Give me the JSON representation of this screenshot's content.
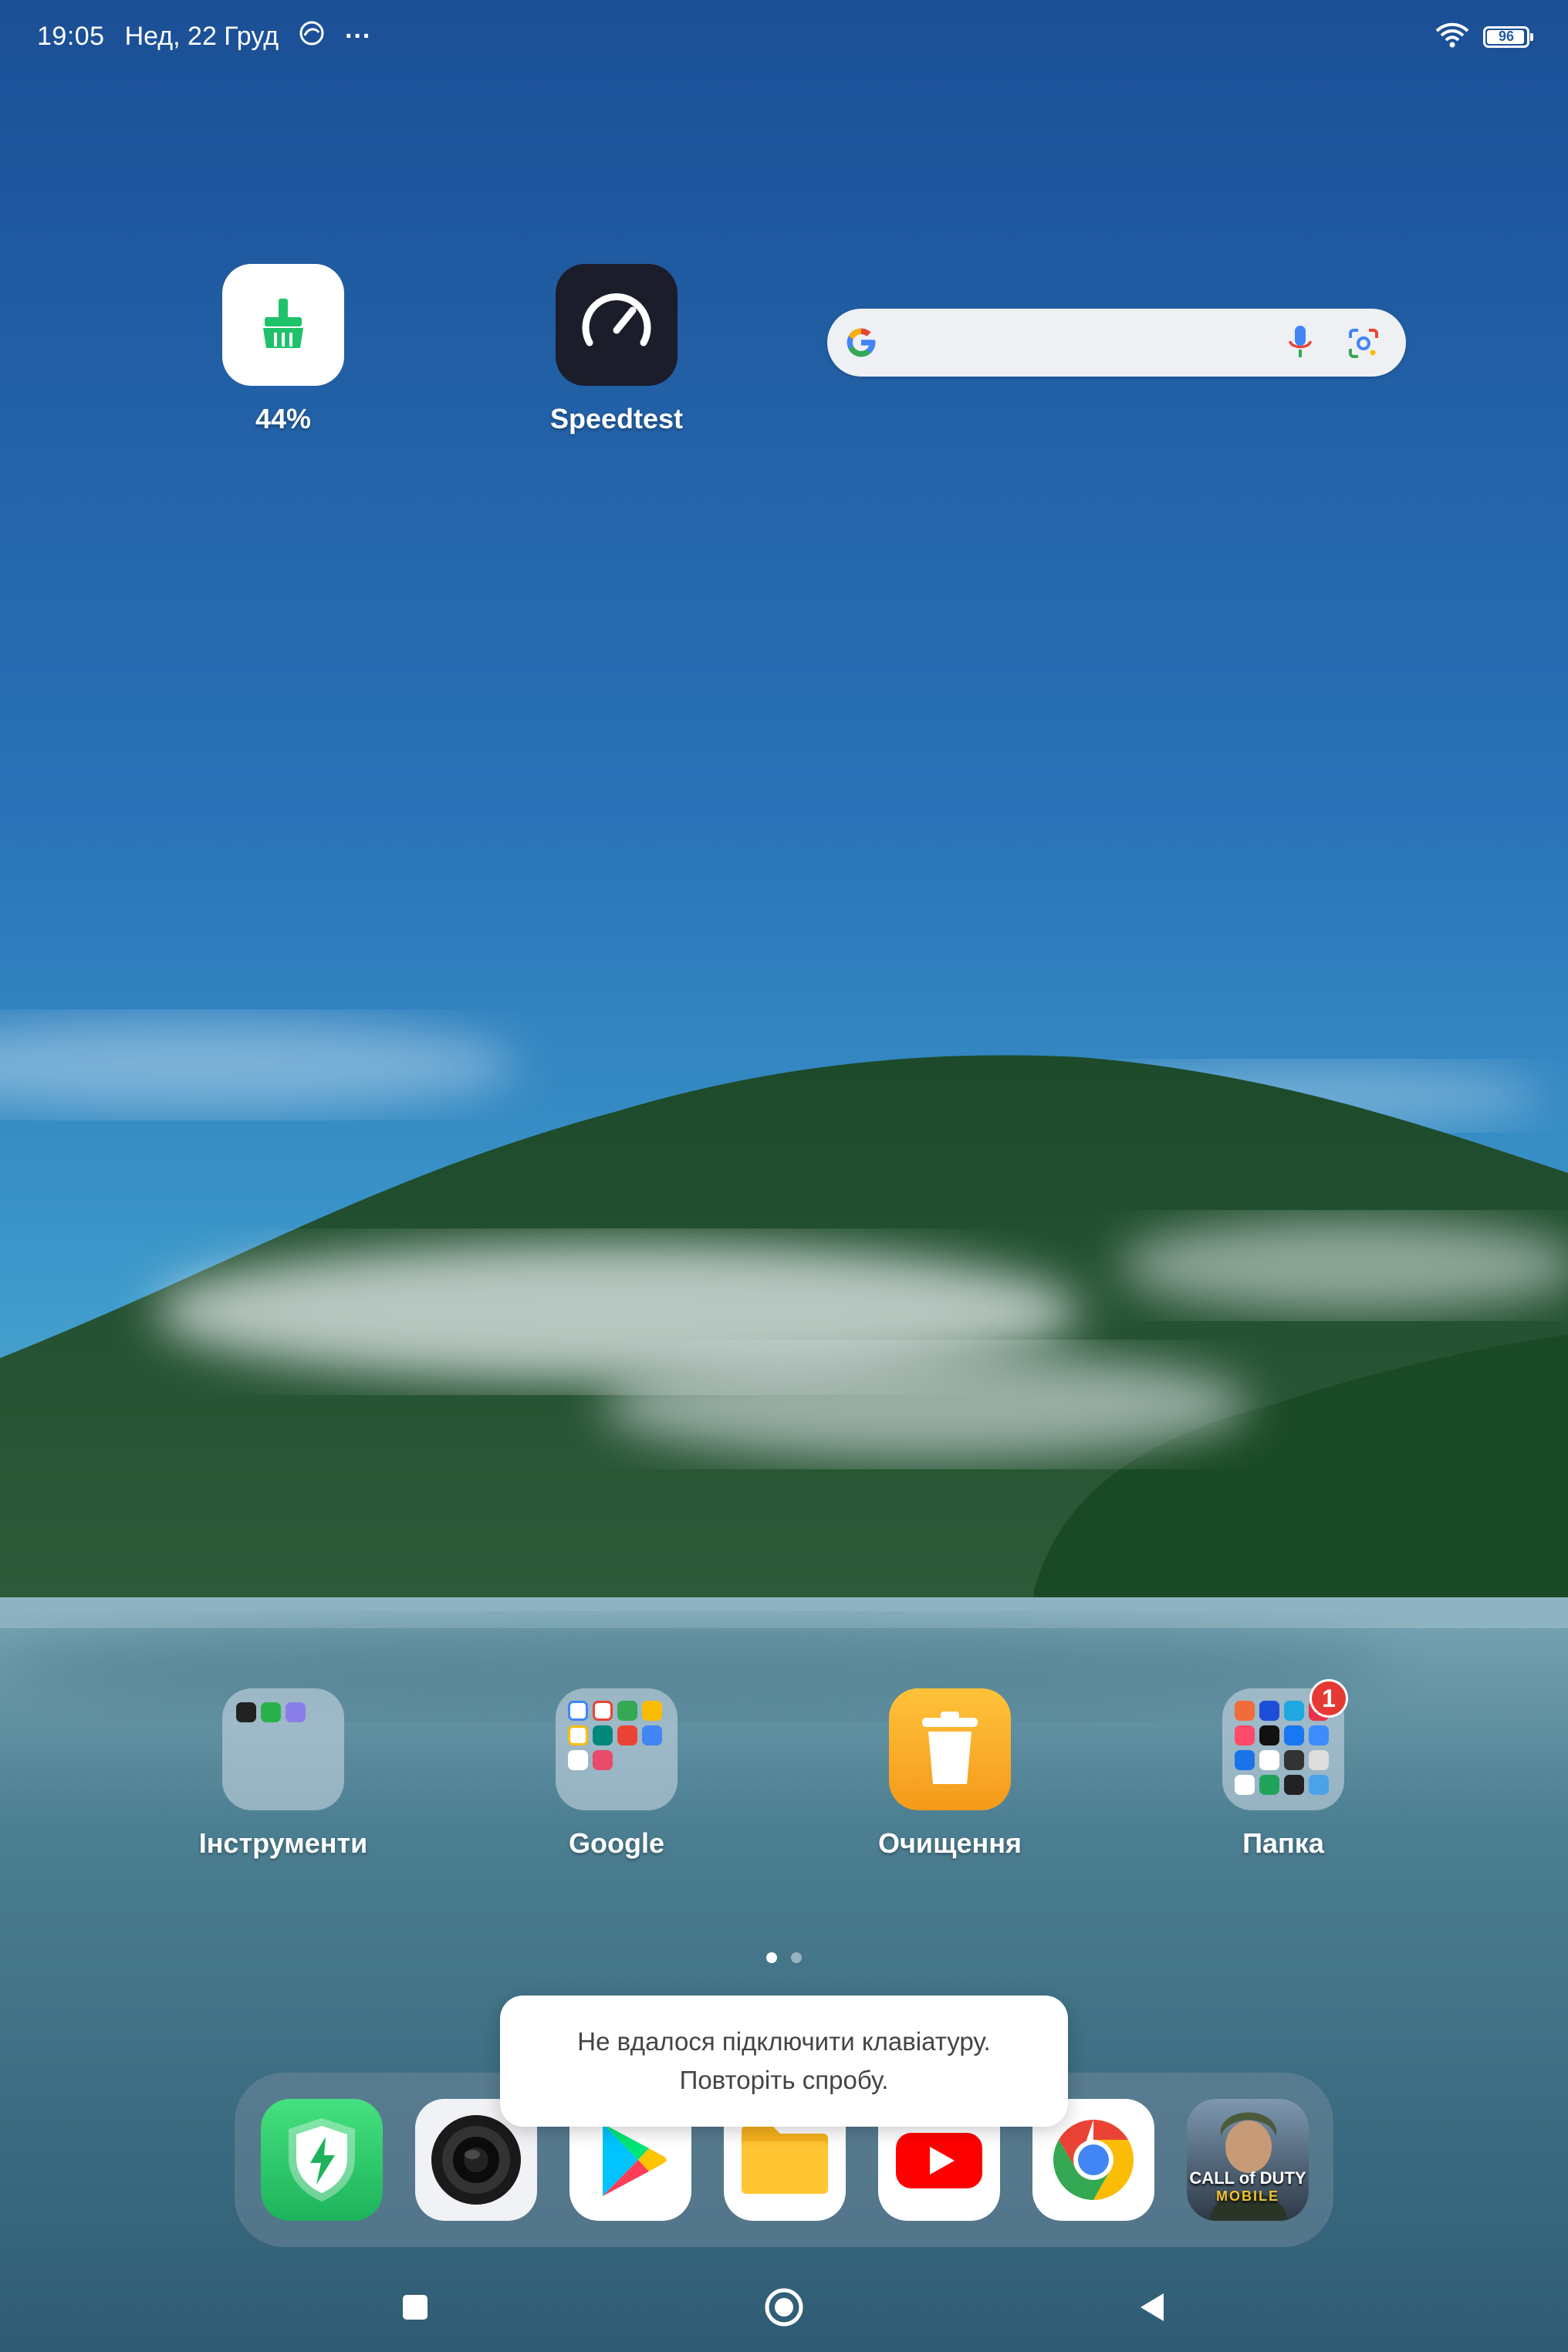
{
  "status_bar": {
    "time": "19:05",
    "date": "Нед, 22 Груд",
    "more_dots": "···",
    "battery_level": 96,
    "battery_text": "96"
  },
  "home": {
    "apps_top": [
      {
        "label": "44%",
        "icon": "cleaner-broom-icon",
        "bg": "#ffffff",
        "accent": "#1ec26a"
      },
      {
        "label": "Speedtest",
        "icon": "speedometer-icon",
        "bg": "#1b1d2b"
      }
    ],
    "search": {
      "placeholder": ""
    },
    "folders_and_apps": [
      {
        "label": "Інструменти",
        "type": "folder"
      },
      {
        "label": "Google",
        "type": "folder"
      },
      {
        "label": "Очищення",
        "type": "app",
        "icon": "trash-icon",
        "bg": "#f5a623"
      },
      {
        "label": "Папка",
        "type": "folder",
        "badge": "1"
      }
    ],
    "page_count": 2,
    "active_page": 0
  },
  "dock": {
    "apps": [
      {
        "name": "security",
        "icon": "shield-bolt-icon",
        "bg": "#2ed36f"
      },
      {
        "name": "camera",
        "icon": "camera-lens-icon",
        "bg": "#f4f4f6"
      },
      {
        "name": "play-store",
        "icon": "play-store-icon",
        "bg": "#ffffff"
      },
      {
        "name": "files",
        "icon": "folder-icon",
        "bg": "#ffffff"
      },
      {
        "name": "youtube",
        "icon": "youtube-icon",
        "bg": "#ffffff"
      },
      {
        "name": "chrome",
        "icon": "chrome-icon",
        "bg": "#ffffff"
      },
      {
        "name": "call-of-duty",
        "icon": "game-soldier-icon",
        "bg": "#3b4a5a",
        "title_line1": "CALL of DUTY",
        "title_line2": "MOBILE"
      }
    ]
  },
  "toast": {
    "line1": "Не вдалося підключити клавіатуру.",
    "line2": "Повторіть спробу."
  },
  "colors": {
    "sky_top": "#1f58a0",
    "sky_mid": "#2f7fbe",
    "forest": "#1d4a2c",
    "lake": "#4a7f93"
  }
}
